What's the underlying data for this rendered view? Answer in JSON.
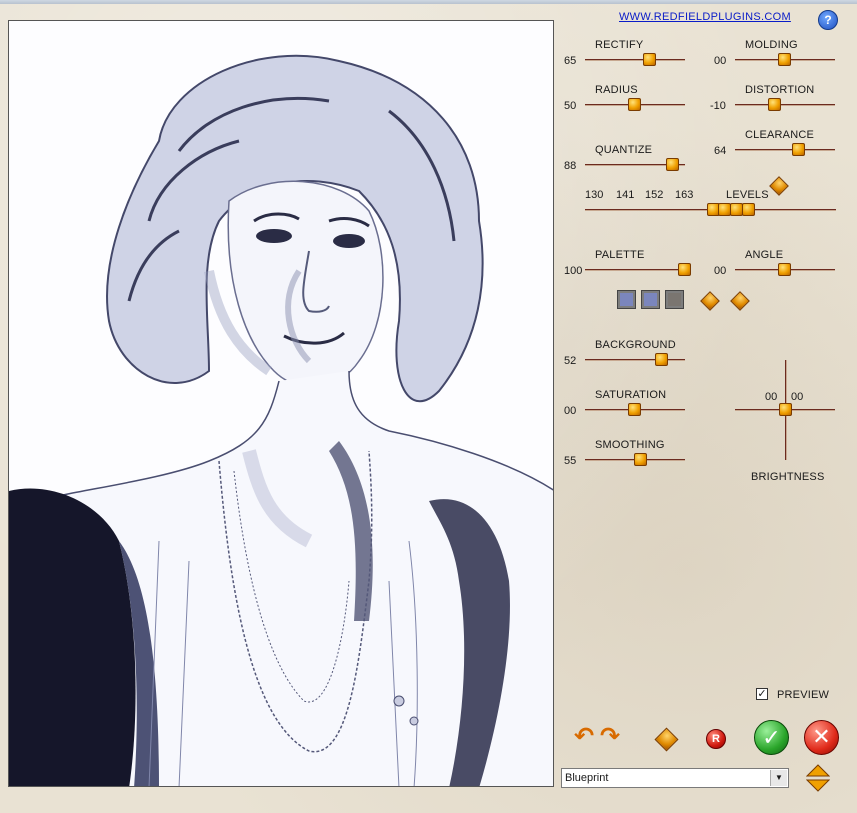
{
  "header": {
    "link_text": "WWW.REDFIELDPLUGINS.COM",
    "help_label": "?"
  },
  "sliders": {
    "rectify": {
      "label": "RECTIFY",
      "value": "65"
    },
    "molding": {
      "label": "MOLDING",
      "value": "00"
    },
    "radius": {
      "label": "RADIUS",
      "value": "50"
    },
    "distortion": {
      "label": "DISTORTION",
      "value": "-10"
    },
    "quantize": {
      "label": "QUANTIZE",
      "value": "88"
    },
    "clearance": {
      "label": "CLEARANCE",
      "value": "64"
    },
    "palette": {
      "label": "PALETTE",
      "value": "100"
    },
    "angle": {
      "label": "ANGLE",
      "value": "00"
    },
    "background": {
      "label": "BACKGROUND",
      "value": "52"
    },
    "saturation": {
      "label": "SATURATION",
      "value": "00"
    },
    "smoothing": {
      "label": "SMOOTHING",
      "value": "55"
    }
  },
  "levels": {
    "label": "LEVELS",
    "values": [
      "130",
      "141",
      "152",
      "163"
    ]
  },
  "brightness": {
    "label": "BRIGHTNESS",
    "x_value": "00",
    "y_value": "00"
  },
  "palette_swatches": [
    "#7b86bd",
    "#7b86bd",
    "#7a7570"
  ],
  "preview": {
    "label": "PREVIEW",
    "checked": "✓"
  },
  "actions": {
    "ok_symbol": "✓",
    "cancel_symbol": "✕",
    "reset_symbol": "R",
    "undo_symbol": "↶",
    "redo_symbol": "↷"
  },
  "preset": {
    "selected": "Blueprint"
  }
}
